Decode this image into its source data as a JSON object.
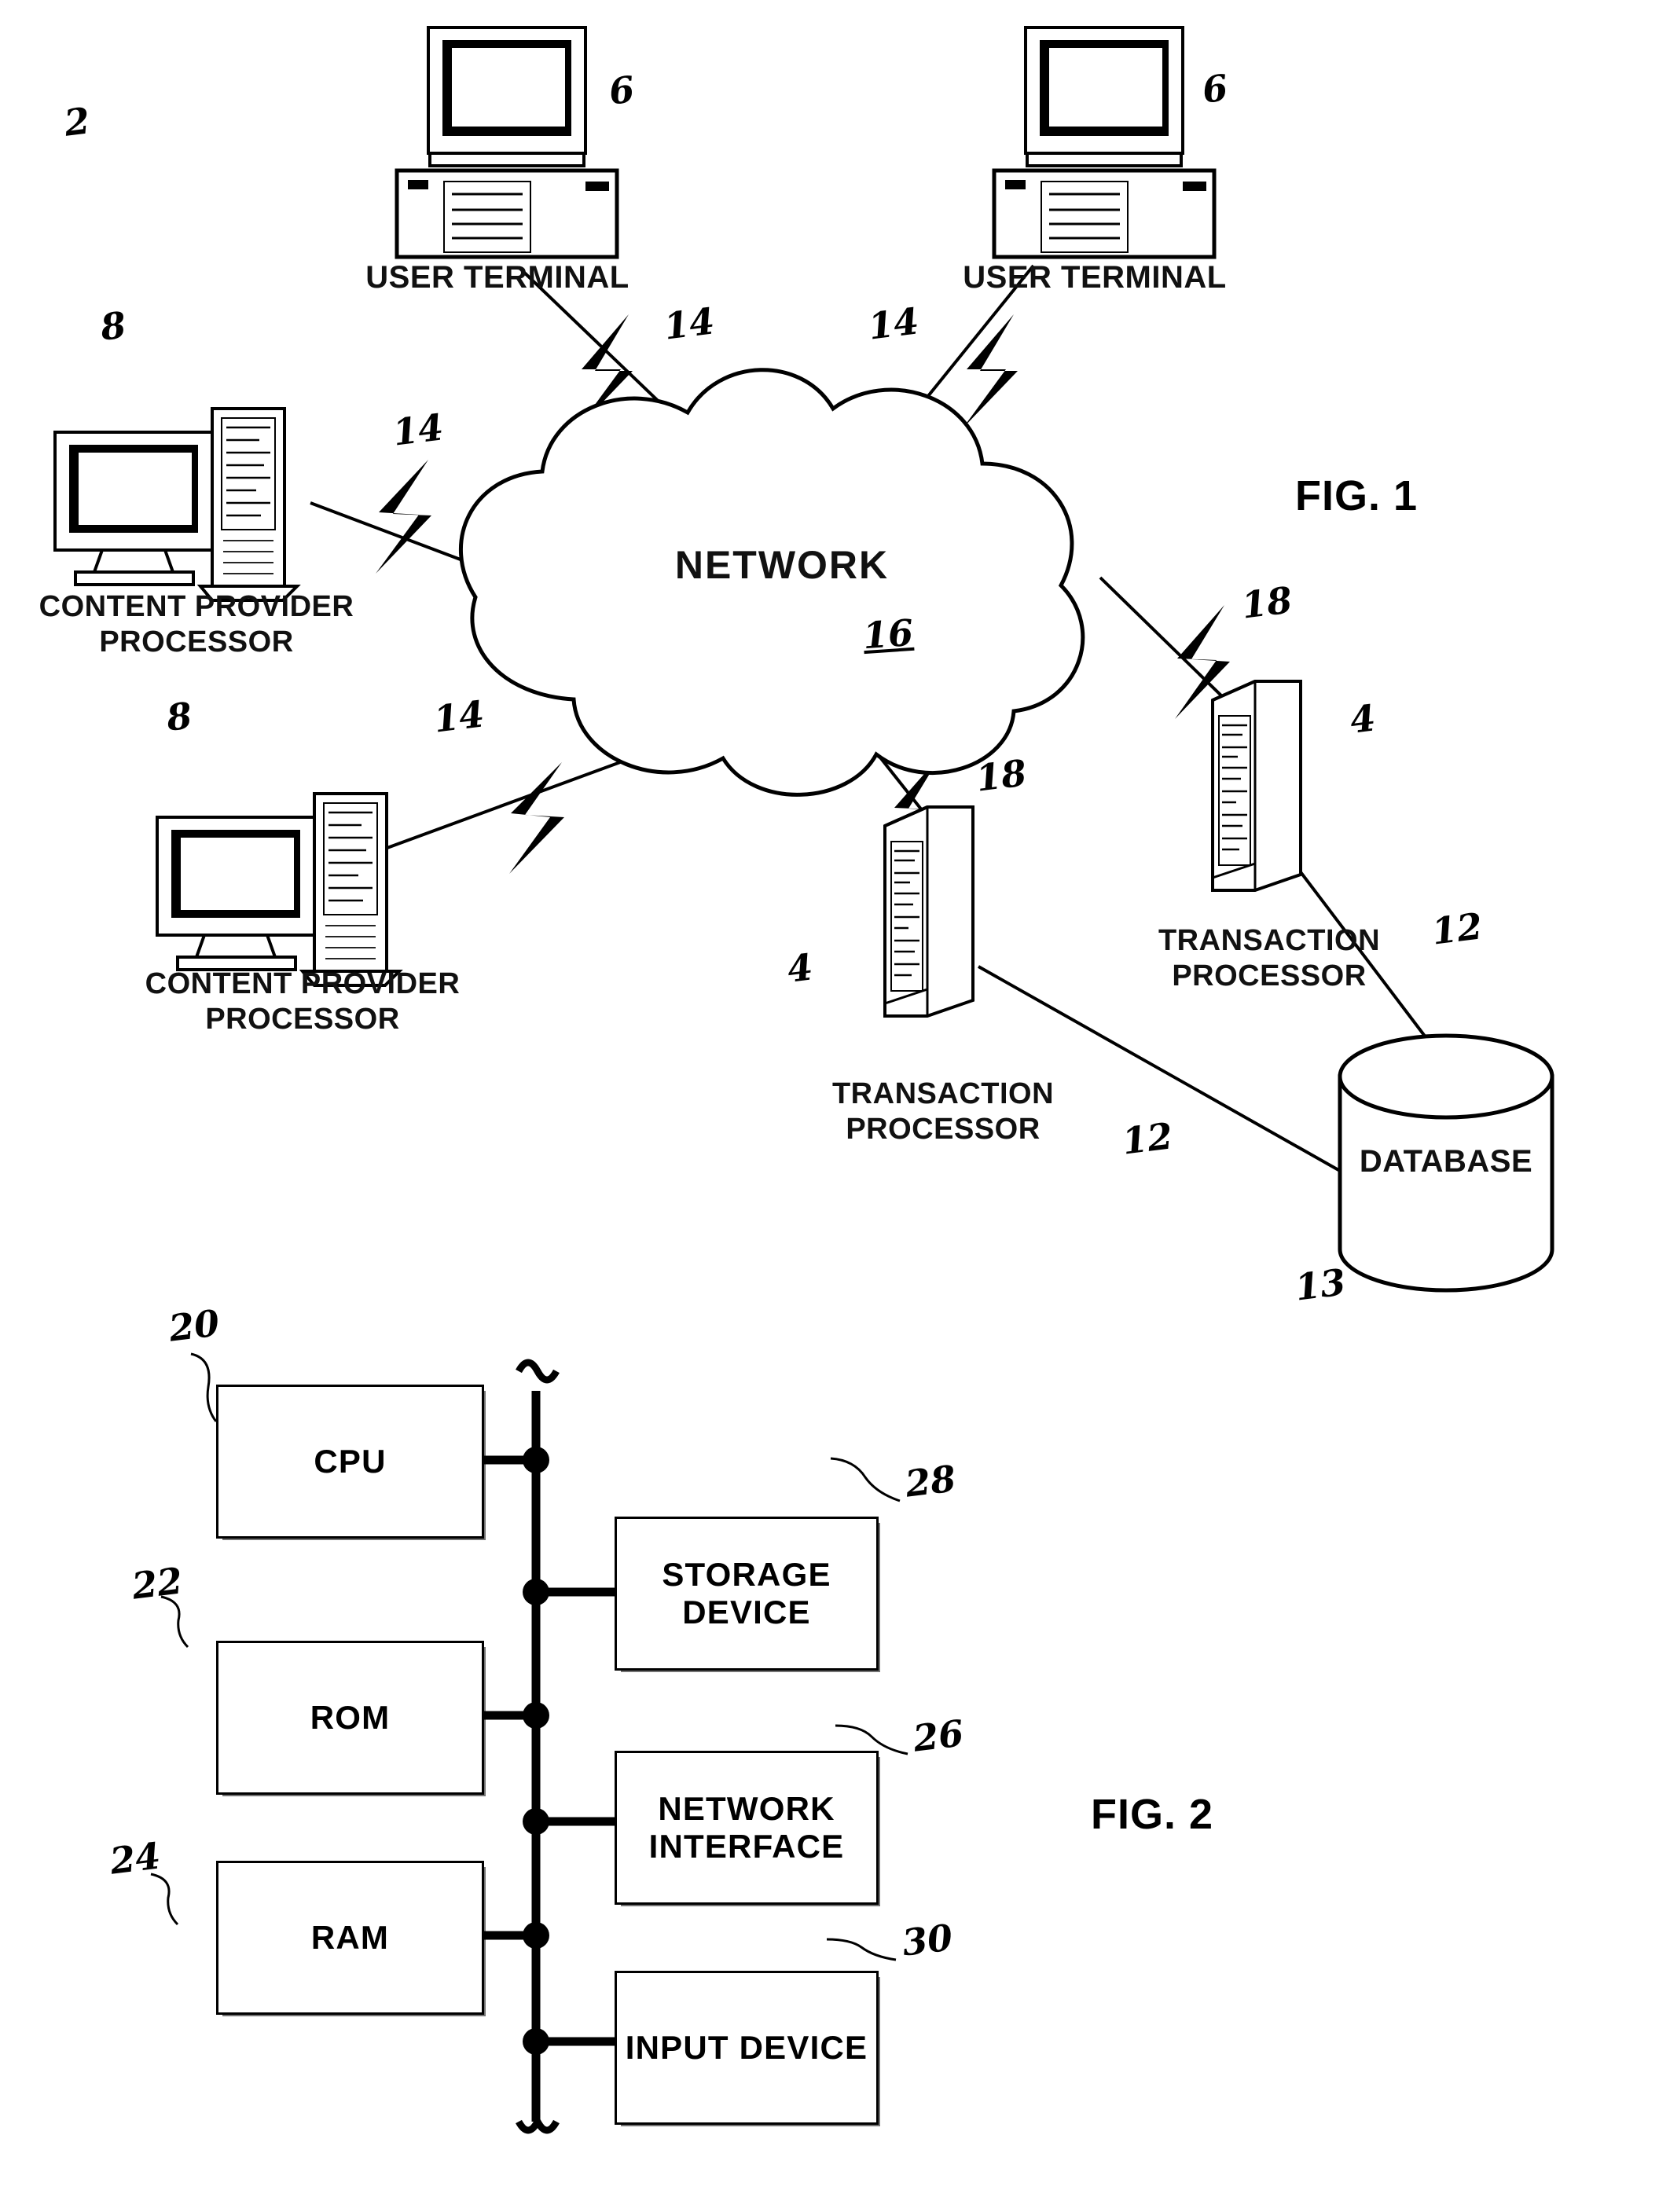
{
  "figures": {
    "fig1_label": "FIG. 1",
    "fig2_label": "FIG. 2"
  },
  "fig1": {
    "system_ref": "2",
    "nodes": [
      {
        "id": "user-terminal-1",
        "label": "USER TERMINAL",
        "ref": "6",
        "kind": "desktop-computer"
      },
      {
        "id": "user-terminal-2",
        "label": "USER TERMINAL",
        "ref": "6",
        "kind": "desktop-computer"
      },
      {
        "id": "content-provider-1",
        "label": "CONTENT PROVIDER\nPROCESSOR",
        "ref": "8",
        "kind": "workstation-tower"
      },
      {
        "id": "content-provider-2",
        "label": "CONTENT PROVIDER\nPROCESSOR",
        "ref": "8",
        "kind": "workstation-tower"
      },
      {
        "id": "network-cloud",
        "label": "NETWORK",
        "ref": "16",
        "kind": "cloud"
      },
      {
        "id": "transaction-processor-1",
        "label": "TRANSACTION\nPROCESSOR",
        "ref": "4",
        "kind": "server-tower"
      },
      {
        "id": "transaction-processor-2",
        "label": "TRANSACTION\nPROCESSOR",
        "ref": "4",
        "kind": "server-tower"
      },
      {
        "id": "database",
        "label": "DATABASE",
        "ref": "13",
        "kind": "cylinder"
      }
    ],
    "link_refs": {
      "user_to_network_a": "14",
      "user_to_network_b": "14",
      "content_to_network_a": "14",
      "content_to_network_b": "14",
      "network_to_transaction_a": "18",
      "network_to_transaction_b": "18",
      "transaction_to_database_a": "12",
      "transaction_to_database_b": "12"
    }
  },
  "fig2": {
    "bus_ref": "",
    "blocks": [
      {
        "id": "cpu",
        "label": "CPU",
        "ref": "20"
      },
      {
        "id": "rom",
        "label": "ROM",
        "ref": "22"
      },
      {
        "id": "ram",
        "label": "RAM",
        "ref": "24"
      },
      {
        "id": "storage-device",
        "label": "STORAGE\nDEVICE",
        "ref": "28"
      },
      {
        "id": "network-interface",
        "label": "NETWORK\nINTERFACE",
        "ref": "26"
      },
      {
        "id": "input-device",
        "label": "INPUT\nDEVICE",
        "ref": "30"
      }
    ]
  },
  "colors": {
    "ink": "#000000",
    "paper": "#ffffff"
  }
}
